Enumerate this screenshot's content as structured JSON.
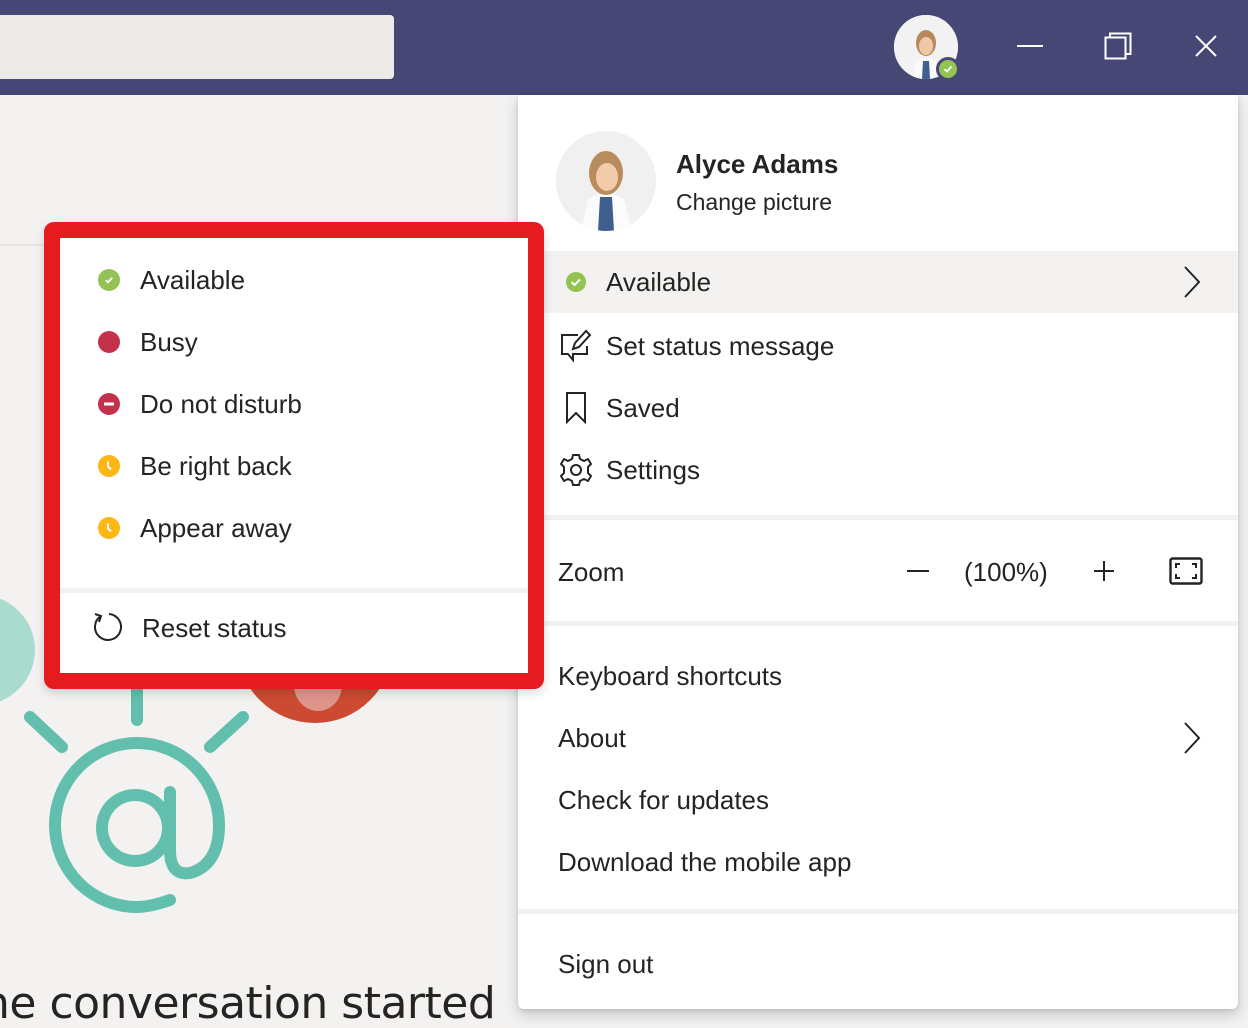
{
  "titlebar": {
    "search_placeholder": "",
    "presence_status": "available",
    "window_controls": [
      "minimize",
      "restore",
      "close"
    ]
  },
  "background": {
    "empty_state_title": "ne conversation started"
  },
  "profile_menu": {
    "user_name": "Alyce Adams",
    "change_picture": "Change picture",
    "status_item": {
      "label": "Available",
      "icon": "available-icon",
      "has_submenu": true
    },
    "items": [
      {
        "label": "Set status message",
        "icon": "edit-message-icon"
      },
      {
        "label": "Saved",
        "icon": "bookmark-icon"
      },
      {
        "label": "Settings",
        "icon": "gear-icon"
      }
    ],
    "zoom": {
      "label": "Zoom",
      "value": "(100%)",
      "minus": "−",
      "plus": "+"
    },
    "links": [
      {
        "label": "Keyboard shortcuts",
        "has_submenu": false
      },
      {
        "label": "About",
        "has_submenu": true
      },
      {
        "label": "Check for updates",
        "has_submenu": false
      },
      {
        "label": "Download the mobile app",
        "has_submenu": false
      }
    ],
    "sign_out": "Sign out"
  },
  "status_menu": {
    "items": [
      {
        "label": "Available",
        "icon": "available-icon",
        "color": "#92c353"
      },
      {
        "label": "Busy",
        "icon": "busy-icon",
        "color": "#c4314b"
      },
      {
        "label": "Do not disturb",
        "icon": "do-not-disturb-icon",
        "color": "#c4314b"
      },
      {
        "label": "Be right back",
        "icon": "clock-icon",
        "color": "#fcb715"
      },
      {
        "label": "Appear away",
        "icon": "clock-icon",
        "color": "#fcb715"
      }
    ],
    "reset": {
      "label": "Reset status",
      "icon": "reset-icon"
    },
    "highlight_color": "#e51b1f"
  },
  "colors": {
    "titlebar": "#464775",
    "available": "#92c353",
    "busy": "#c4314b",
    "away": "#fcb715",
    "illustration_teal": "#62bfad",
    "illustration_red": "#cc4a31"
  }
}
